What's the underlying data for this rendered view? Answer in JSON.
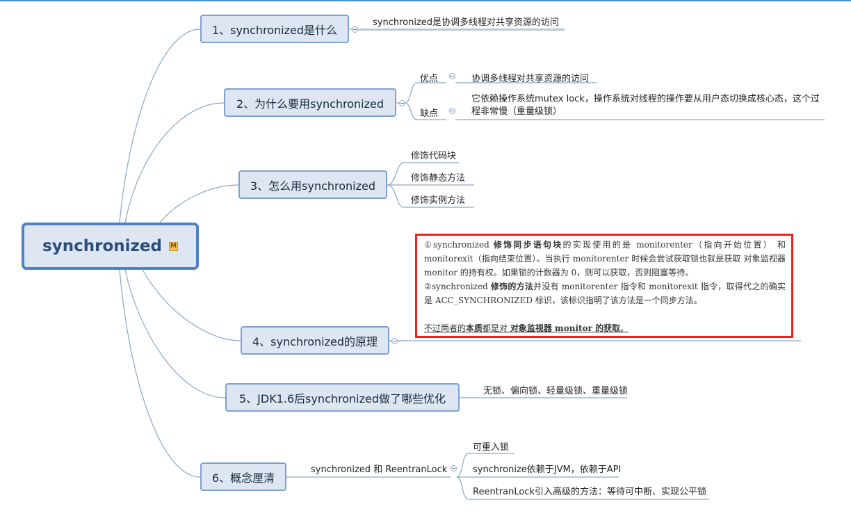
{
  "root": {
    "label": "synchronized",
    "badge": "M"
  },
  "branches": [
    {
      "label": "1、synchronized是什么",
      "leaves": [
        "synchronized是协调多线程对共享资源的访问"
      ]
    },
    {
      "label": "2、为什么要用synchronized",
      "groups": [
        {
          "label": "优点",
          "text": "协调多线程对共享资源的访问"
        },
        {
          "label": "缺点",
          "text": "它依赖操作系统mutex lock，操作系统对线程的操作要从用户态切换成核心态，这个过程非常慢（重量级锁）"
        }
      ]
    },
    {
      "label": "3、怎么用synchronized",
      "leaves": [
        "修饰代码块",
        "修饰静态方法",
        "修饰实例方法"
      ]
    },
    {
      "label": "4、synchronized的原理",
      "note": {
        "p1_a": "①synchronized ",
        "p1_b": "修饰同步语句块",
        "p1_c": "的实现使用的是 monitorenter（指向开始位置） 和 monitorexit（指向结束位置）。当执行 monitorenter 时候会尝试获取锁也就是获取 对象监视器 monitor 的持有权。如果锁的计数器为 0，则可以获取，否则阻塞等待。",
        "p2_a": "②synchronized ",
        "p2_b": "修饰的方法",
        "p2_c": "并没有 monitorenter 指令和 monitorexit 指令，取得代之的确实是 ACC_SYNCHRONIZED 标识，该标识指明了该方法是一个同步方法。",
        "p3_a": "不过两者的",
        "p3_b": "本质",
        "p3_c": "都是对 ",
        "p3_d": "对象监视器 monitor 的获取",
        "p3_e": "。"
      }
    },
    {
      "label": "5、JDK1.6后synchronized做了哪些优化",
      "leaves": [
        "无锁、偏向锁、轻量级锁、重量级锁"
      ]
    },
    {
      "label": "6、概念厘清",
      "sub": "synchronized 和 ReentranLock",
      "leaves": [
        "可重入锁",
        "synchronize依赖于JVM，依赖于API",
        "ReentranLock引入高级的方法：等待可中断、实现公平锁"
      ]
    }
  ]
}
